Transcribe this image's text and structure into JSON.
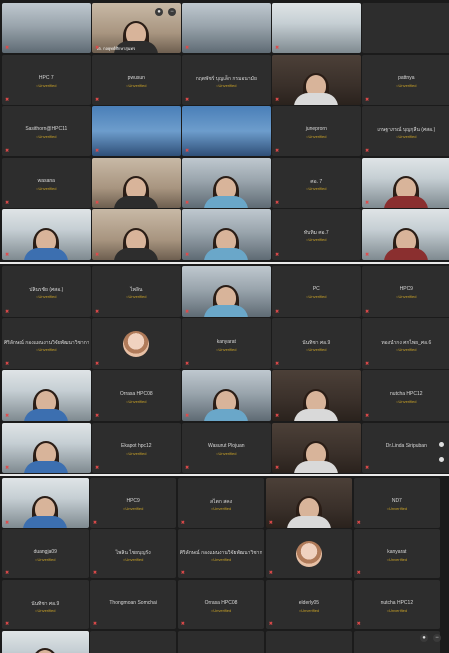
{
  "colors": {
    "panel_bg": "#1b1b1b",
    "tile_bg": "#2d2d2d",
    "unverified": "#c9a227",
    "muted_mic": "#e04a4a"
  },
  "panel1": {
    "tiles": [
      {
        "name": "",
        "status": "",
        "kind": "video-room"
      },
      {
        "name": "วต. กลยุทธ์ศึกษาสุนทร",
        "status": "",
        "kind": "video-person"
      },
      {
        "name": "",
        "status": "",
        "kind": "video-room"
      },
      {
        "name": "",
        "status": "",
        "kind": "video-office"
      },
      {
        "name": "",
        "status": "",
        "kind": "empty"
      },
      {
        "name": "HPC 7",
        "status": "Unverified",
        "kind": "name"
      },
      {
        "name": "pwusun",
        "status": "Unverified",
        "kind": "name"
      },
      {
        "name": "กฤตพัชร์ บุญเล็ก กรมอนามัย",
        "status": "Unverified",
        "kind": "name"
      },
      {
        "name": "",
        "status": "",
        "kind": "video-person"
      },
      {
        "name": "pattnya",
        "status": "Unverified",
        "kind": "name"
      },
      {
        "name": "Sasithorn@HPC11",
        "status": "Unverified",
        "kind": "name"
      },
      {
        "name": "",
        "status": "",
        "kind": "video-blue"
      },
      {
        "name": "",
        "status": "",
        "kind": "video-blue"
      },
      {
        "name": "juneprorn",
        "status": "Unverified",
        "kind": "name"
      },
      {
        "name": "เกษฐาภรณ์ บุญกุลีน (ศสอ.)",
        "status": "Unverified",
        "kind": "name"
      },
      {
        "name": "wasana",
        "status": "Unverified",
        "kind": "name"
      },
      {
        "name": "",
        "status": "",
        "kind": "video-person"
      },
      {
        "name": "",
        "status": "",
        "kind": "video-person"
      },
      {
        "name": "ศอ. 7",
        "status": "Unverified",
        "kind": "name"
      },
      {
        "name": "",
        "status": "",
        "kind": "video-person"
      },
      {
        "name": "",
        "status": "",
        "kind": "video-person"
      },
      {
        "name": "",
        "status": "",
        "kind": "video-person"
      },
      {
        "name": "",
        "status": "",
        "kind": "video-person"
      },
      {
        "name": "ทับทิม ศอ.7",
        "status": "Unverified",
        "kind": "name"
      },
      {
        "name": "",
        "status": "",
        "kind": "video-person"
      }
    ]
  },
  "panel2": {
    "tiles": [
      {
        "name": "ปลินรชัย (ศสอ.)",
        "status": "Unverified",
        "kind": "name"
      },
      {
        "name": "ไพลิน",
        "status": "Unverified",
        "kind": "name"
      },
      {
        "name": "",
        "status": "",
        "kind": "video-person"
      },
      {
        "name": "PC",
        "status": "Unverified",
        "kind": "name"
      },
      {
        "name": "HPC9",
        "status": "Unverified",
        "kind": "name"
      },
      {
        "name": "ศิริลักษณ์ กองแผนงานวิจัยพัฒนาวิชาการ",
        "status": "Unverified",
        "kind": "name"
      },
      {
        "name": "",
        "status": "",
        "kind": "avatar"
      },
      {
        "name": "kanyarat",
        "status": "Unverified",
        "kind": "name"
      },
      {
        "name": "นันทิชา ศอ.9",
        "status": "Unverified",
        "kind": "name"
      },
      {
        "name": "ทองนำกง ศกไพย_ศอ.6",
        "status": "Unverified",
        "kind": "name"
      },
      {
        "name": "",
        "status": "",
        "kind": "video-person"
      },
      {
        "name": "Orrasa HPC08",
        "status": "Unverified",
        "kind": "name"
      },
      {
        "name": "",
        "status": "",
        "kind": "video-person"
      },
      {
        "name": "",
        "status": "",
        "kind": "video-person"
      },
      {
        "name": "nutcha HPC12",
        "status": "Unverified",
        "kind": "name"
      },
      {
        "name": "",
        "status": "",
        "kind": "video-person"
      },
      {
        "name": "Ekapot hpc12",
        "status": "Unverified",
        "kind": "name"
      },
      {
        "name": "Wasurut Plojuan",
        "status": "Unverified",
        "kind": "name"
      },
      {
        "name": "",
        "status": "",
        "kind": "video-person"
      },
      {
        "name": "Dr.Linda Siripuban",
        "status": "",
        "kind": "name"
      }
    ]
  },
  "panel3": {
    "tiles": [
      {
        "name": "",
        "status": "",
        "kind": "video-person"
      },
      {
        "name": "HPC9",
        "status": "Unverified",
        "kind": "name"
      },
      {
        "name": "สไตก สคง",
        "status": "Unverified",
        "kind": "name"
      },
      {
        "name": "",
        "status": "",
        "kind": "video-person"
      },
      {
        "name": "ND7",
        "status": "Unverified",
        "kind": "name"
      },
      {
        "name": "duangja09",
        "status": "Unverified",
        "kind": "name"
      },
      {
        "name": "ไพลิน ไชยบุญรัง",
        "status": "Unverified",
        "kind": "name"
      },
      {
        "name": "ศิริลักษณ์ กองแผนงานวิจัยพัฒนาวิชาการ",
        "status": "Unverified",
        "kind": "name"
      },
      {
        "name": "",
        "status": "",
        "kind": "avatar"
      },
      {
        "name": "kanyarat",
        "status": "Unverified",
        "kind": "name"
      },
      {
        "name": "นันทิชา ศอ.9",
        "status": "Unverified",
        "kind": "name"
      },
      {
        "name": "Thongmoan Somchai",
        "status": "",
        "kind": "name"
      },
      {
        "name": "Orrasa HPC08",
        "status": "Unverified",
        "kind": "name"
      },
      {
        "name": "elderly05",
        "status": "Unverified",
        "kind": "name"
      },
      {
        "name": "nutcha HPC12",
        "status": "Unverified",
        "kind": "name"
      },
      {
        "name": "",
        "status": "",
        "kind": "video-person"
      },
      {
        "name": "",
        "status": "",
        "kind": "empty"
      },
      {
        "name": "",
        "status": "",
        "kind": "empty"
      },
      {
        "name": "",
        "status": "",
        "kind": "empty"
      },
      {
        "name": "",
        "status": "",
        "kind": "empty"
      }
    ]
  }
}
